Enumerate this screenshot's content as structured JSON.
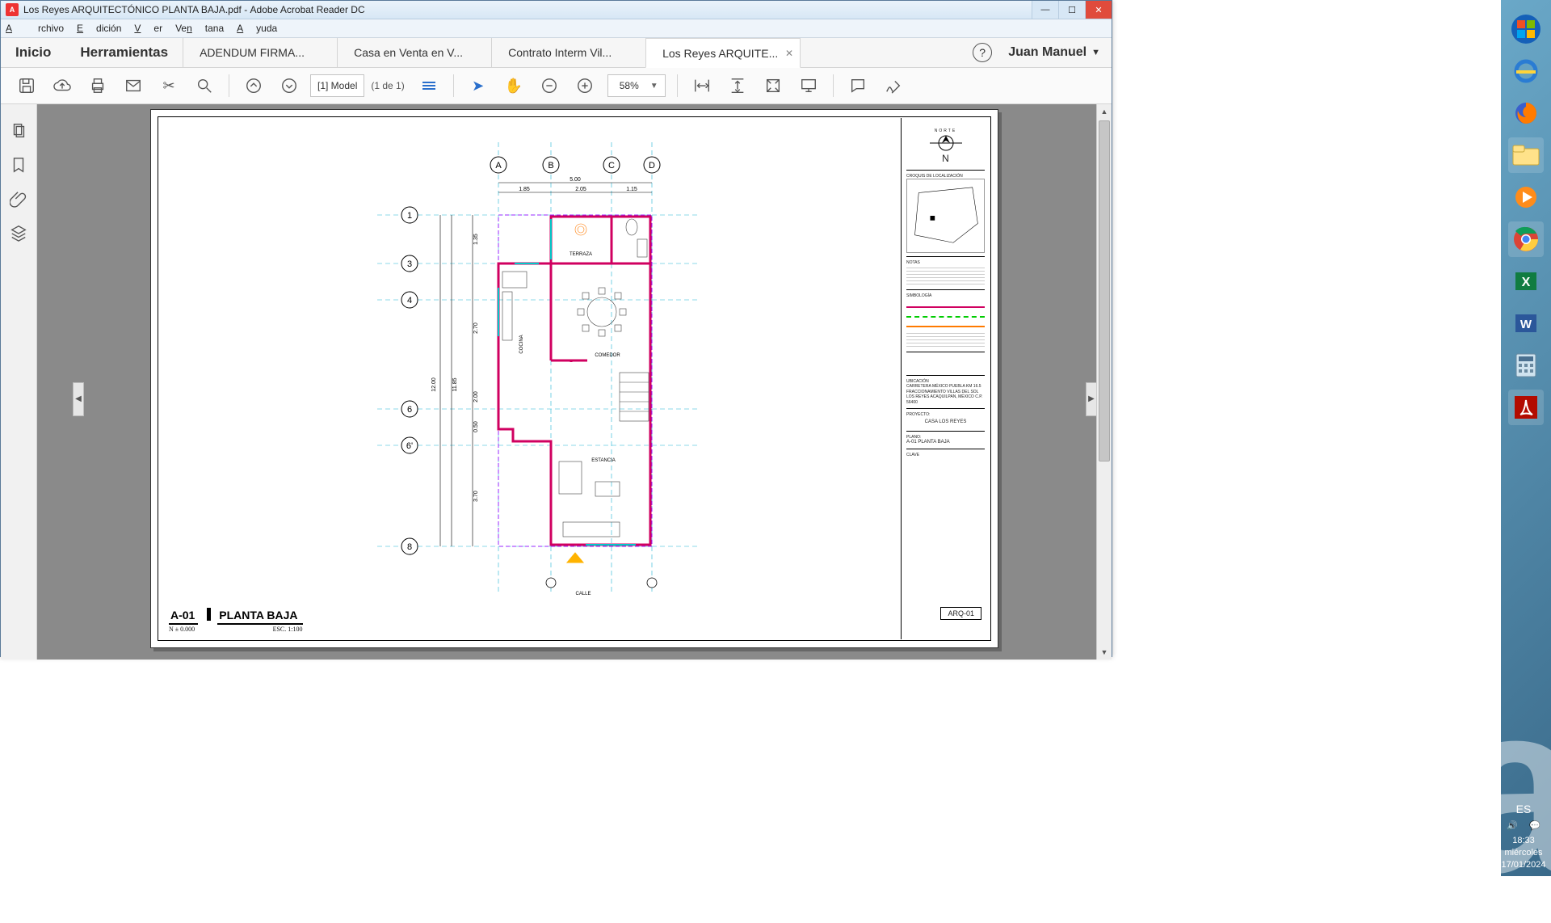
{
  "titlebar": {
    "filename": "Los Reyes ARQUITECTÓNICO PLANTA BAJA.pdf",
    "app": "Adobe Acrobat Reader DC"
  },
  "menus": {
    "archivo": "Archivo",
    "edicion": "Edición",
    "ver": "Ver",
    "ventana": "Ventana",
    "ayuda": "Ayuda"
  },
  "hometabs": {
    "inicio": "Inicio",
    "herramientas": "Herramientas"
  },
  "doctabs": [
    {
      "label": "ADENDUM FIRMA..."
    },
    {
      "label": "Casa en Venta en V..."
    },
    {
      "label": "Contrato Interm Vil..."
    },
    {
      "label": "Los Reyes ARQUITE...",
      "active": true
    }
  ],
  "user": {
    "name": "Juan Manuel"
  },
  "toolbar": {
    "model": "[1] Model",
    "page_of": "(1 de 1)",
    "zoom": "58%"
  },
  "drawing": {
    "code": "A-01",
    "title": "PLANTA BAJA",
    "level": "N ± 0.000",
    "scale": "ESC. 1:100",
    "bottom_label": "CALLE",
    "col_grids": [
      "A",
      "B",
      "C",
      "D"
    ],
    "row_grids": [
      "1",
      "3",
      "4",
      "6",
      "6'",
      "8"
    ],
    "rooms": {
      "terraza": "TERRAZA",
      "cocina": "COCINA",
      "comedor": "COMEDOR",
      "estancia": "ESTANCIA"
    },
    "dims": {
      "top_total": "5.00",
      "top_a": "1.85",
      "top_b": "2.05",
      "top_c": "1.15",
      "left_total": "12.00",
      "left_inner": "11.85",
      "l1": "1.35",
      "l2": "2.70",
      "l3": "2.00",
      "l4": "0.50",
      "l5": "3.70"
    },
    "tb": {
      "north_hdr": "NORTE",
      "north_letter": "N",
      "croquis": "CROQUIS DE LOCALIZACIÓN",
      "notas": "NOTAS",
      "simbologia": "SIMBOLOGÍA",
      "ubicacion_hdr": "UBICACIÓN",
      "ubicacion": "CARRETERA MÉXICO PUEBLA KM 16.5 FRACCIONAMIENTO VILLAS DEL SOL LOS REYES ACAQUILPAN, MÉXICO C.P. 56400",
      "proyecto_hdr": "PROYECTO:",
      "proyecto": "CASA LOS REYES",
      "plano_hdr": "PLANO:",
      "plano": "A-01 PLANTA BAJA",
      "clave_hdr": "CLAVE",
      "clave": "ARQ-01"
    }
  },
  "systray": {
    "lang": "ES",
    "time": "18:33",
    "day": "miércoles",
    "date": "17/01/2024"
  },
  "taskbar_icons": [
    "start",
    "ie",
    "firefox",
    "explorer",
    "wmp",
    "chrome",
    "excel",
    "word",
    "calc",
    "acrobat"
  ]
}
